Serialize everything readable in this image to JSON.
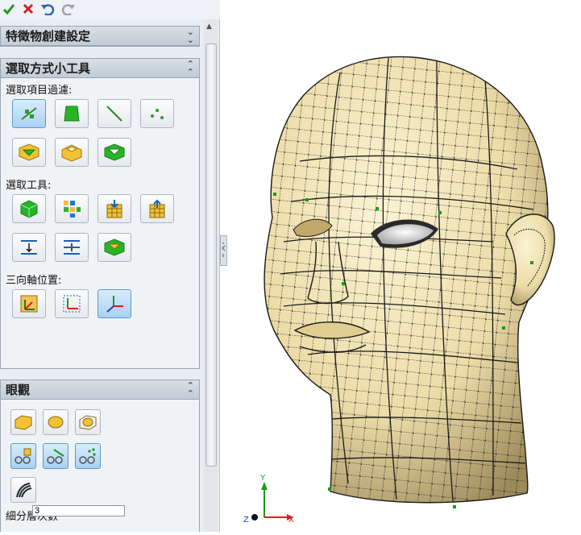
{
  "toolbar": {
    "ok_icon": "checkmark-icon",
    "cancel_icon": "cross-icon",
    "undo_icon": "undo-icon",
    "redo_icon": "redo-icon"
  },
  "sections": {
    "feature_settings": {
      "title": "特徵物創建設定"
    },
    "selection_tools": {
      "title": "選取方式小工具",
      "filter_label": "選取項目過濾:",
      "tools_label": "選取工具:",
      "triad_label": "三向軸位置:"
    },
    "display": {
      "title": "眼觀",
      "subdivision_label": "細分層次數",
      "subdivision_value": "3"
    }
  },
  "colors": {
    "accent": "#1e7ac6",
    "mesh_surface": "#efe2b3",
    "mesh_lines": "#1a1a1a",
    "axis_x": "#d62020",
    "axis_y": "#1a9b1a",
    "axis_z": "#2040c8"
  },
  "triad": {
    "x": "X",
    "y": "Y",
    "z": "Z"
  }
}
